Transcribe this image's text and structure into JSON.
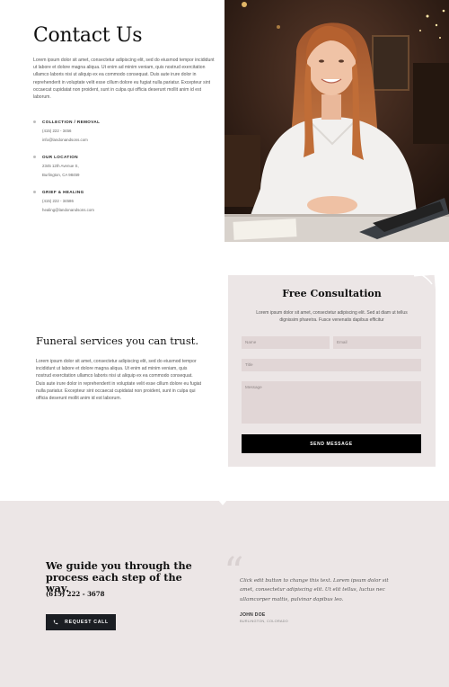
{
  "contact": {
    "title": "Contact Us",
    "intro": "Lorem ipsum dolor sit amet, consectetur adipiscing elit, sed do eiusmod tempor incididunt ut labore et dolore magna aliqua. Ut enim ad minim veniam, quis nostrud exercitation ullamco laboris nisi ut aliquip ex ea commodo consequat. Duis aute irure dolor in reprehenderit in voluptate velit esse cillum dolore eu fugiat nulla pariatur. Excepteur sint occaecat cupidatat non proident, sunt in culpa qui officia deserunt mollit anim id est laborum.",
    "blocks": [
      {
        "heading": "COLLECTION / REMOVAL",
        "line1": "(415) 222 - 3456",
        "line2": "info@landonandsons.com"
      },
      {
        "heading": "OUR LOCATION",
        "line1": "2345 12th Avenue S,",
        "line2": "Burlington, CA 98459"
      },
      {
        "heading": "GRIEF & HEALING",
        "line1": "(415) 222 - 34586",
        "line2": "healing@landonandsons.com"
      }
    ]
  },
  "trust": {
    "title": "Funeral services you can trust.",
    "body": "Lorem ipsum dolor sit amet, consectetur adipiscing elit, sed do eiusmod tempor incididunt ut labore et dolore magna aliqua. Ut enim ad minim veniam, quis nostrud exercitation ullamco laboris nisi ut aliquip ex ea commodo consequat. Duis aute irure dolor in reprehenderit in voluptate velit esse cillum dolore eu fugiat nulla pariatur. Excepteur sint occaecat cupidatat non proident, sunt in culpa qui officia deserunt mollit anim id est laborum."
  },
  "form": {
    "title": "Free Consultation",
    "description": "Lorem ipsum dolor sit amet, consectetur adipiscing elit. Sed at diam ut tellus dignissim pharetra. Fusce venenatis dapibus efficitur",
    "name_placeholder": "Name",
    "email_placeholder": "Email",
    "title_placeholder": "Title",
    "message_placeholder": "Message",
    "submit_label": "SEND MESSAGE"
  },
  "guide": {
    "title": "We guide you through the process each step of the way.",
    "phone": "(615) 222 - 3678",
    "button_label": "REQUEST CALL",
    "quote": "Click edit button to change this text. Lorem ipsum dolor sit amet, consectetur adipiscing elit. Ut elit tellus, luctus nec ullamcorper mattis, pulvinar dapibus leo.",
    "author": "JOHN DOE",
    "location": "BURLINGTON, COLORADO"
  },
  "icons": {
    "phone": "phone-icon",
    "quote": "quote-icon",
    "bullet": "bullet-dot-icon"
  },
  "colors": {
    "accent_bg": "#ece6e6",
    "field_bg": "#e1d6d6",
    "button_dark": "#000000",
    "call_button": "#1b1e23"
  }
}
